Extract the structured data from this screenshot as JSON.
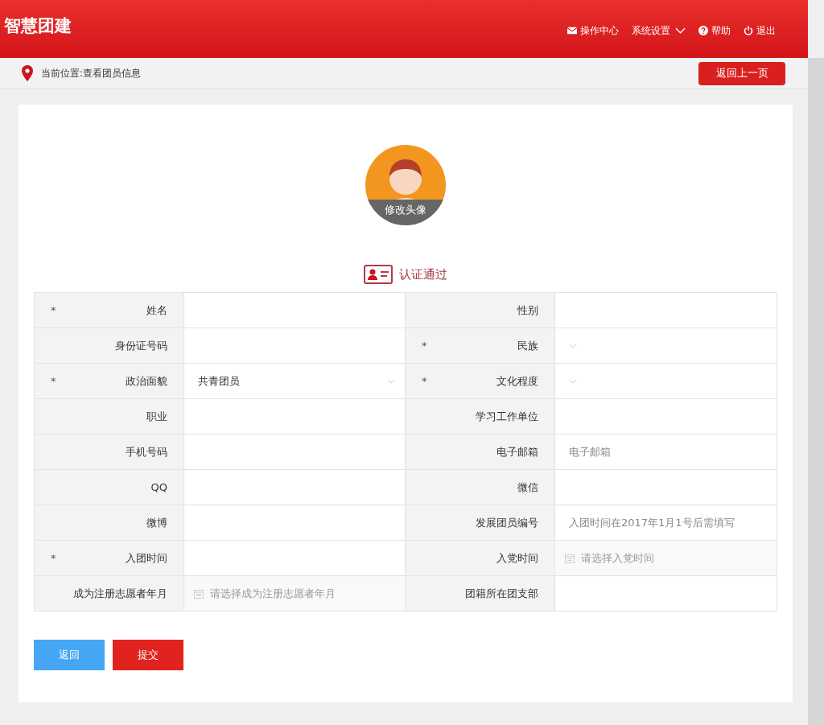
{
  "header": {
    "title": "智慧团建",
    "nav": [
      {
        "kind": "mail",
        "label": "操作中心"
      },
      {
        "kind": "dropdown",
        "label": "系统设置"
      },
      {
        "kind": "help",
        "label": "帮助"
      },
      {
        "kind": "power",
        "label": "退出"
      }
    ]
  },
  "breadcrumb": {
    "text": "当前位置:查看团员信息",
    "back_button": "返回上一页"
  },
  "avatar": {
    "caption": "修改头像"
  },
  "status": {
    "text": "认证通过"
  },
  "form": {
    "rows": [
      [
        {
          "label": "姓名",
          "required_mark": "*",
          "kind": "text"
        },
        {
          "label": "性别",
          "kind": "text"
        }
      ],
      [
        {
          "label": "身份证号码",
          "kind": "text"
        },
        {
          "label": "民族",
          "required_mark": "*",
          "kind": "select"
        }
      ],
      [
        {
          "label": "政治面貌",
          "required_mark": "*",
          "kind": "select",
          "value": "共青团员"
        },
        {
          "label": "文化程度",
          "required_mark": "*",
          "kind": "select"
        }
      ],
      [
        {
          "label": "职业",
          "kind": "text"
        },
        {
          "label": "学习工作单位",
          "kind": "text"
        }
      ],
      [
        {
          "label": "手机号码",
          "kind": "text"
        },
        {
          "label": "电子邮箱",
          "kind": "text",
          "placeholder": "电子邮箱"
        }
      ],
      [
        {
          "label": "QQ",
          "kind": "text"
        },
        {
          "label": "微信",
          "kind": "text"
        }
      ],
      [
        {
          "label": "微博",
          "kind": "text"
        },
        {
          "label": "发展团员编号",
          "kind": "text",
          "placeholder": "入团时间在2017年1月1号后需填写"
        }
      ],
      [
        {
          "label": "入团时间",
          "required_mark": "*",
          "kind": "text"
        },
        {
          "label": "入党时间",
          "kind": "date",
          "placeholder": "请选择入党时间"
        }
      ],
      [
        {
          "label": "成为注册志愿者年月",
          "kind": "date",
          "placeholder": "请选择成为注册志愿者年月"
        },
        {
          "label": "团籍所在团支部",
          "kind": "text"
        }
      ]
    ]
  },
  "buttons": [
    {
      "kind": "secondary",
      "label": "返回"
    },
    {
      "kind": "primary",
      "label": "提交"
    }
  ]
}
